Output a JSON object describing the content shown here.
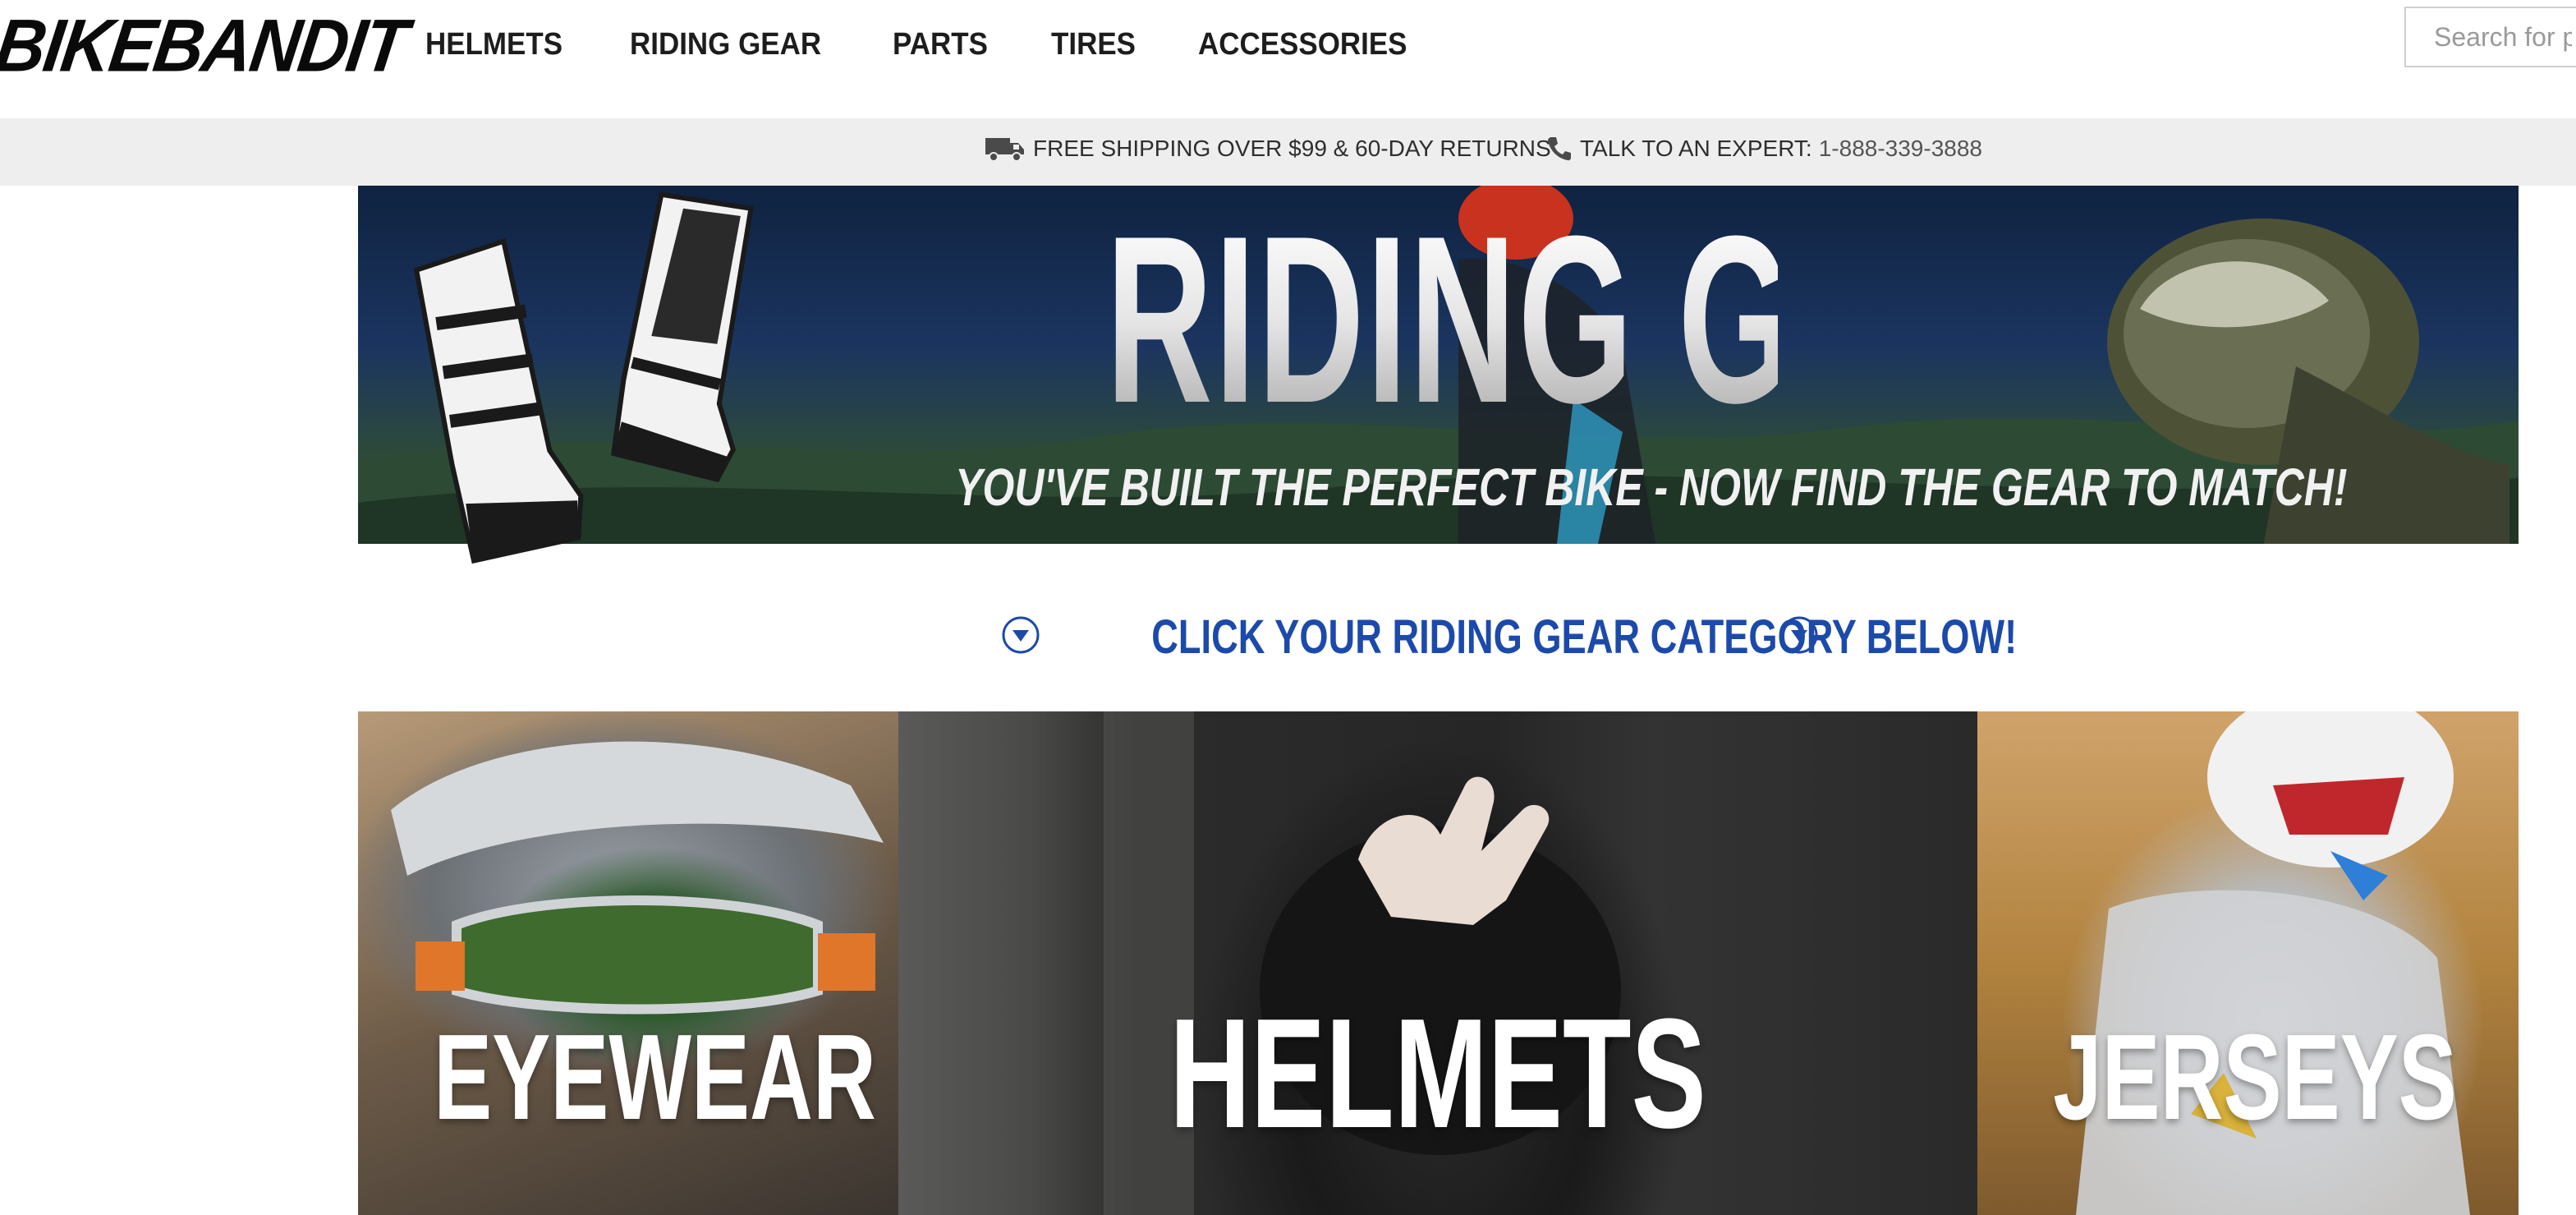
{
  "header": {
    "logo_text": "BIKEBANDIT",
    "nav": [
      {
        "label": "HELMETS"
      },
      {
        "label": "RIDING GEAR"
      },
      {
        "label": "PARTS"
      },
      {
        "label": "TIRES"
      },
      {
        "label": "ACCESSORIES"
      }
    ],
    "search_placeholder": "Search for p"
  },
  "infobar": {
    "shipping_icon": "truck-icon",
    "shipping_text": "FREE SHIPPING OVER $99 & 60-DAY RETURNS",
    "phone_icon": "phone-icon",
    "phone_label": "TALK TO AN EXPERT:",
    "phone_number": "1-888-339-3888"
  },
  "hero": {
    "title": "RIDING GEAR",
    "subtitle": "YOU'VE BUILT THE PERFECT BIKE - NOW FIND THE GEAR TO MATCH!"
  },
  "cta": {
    "text": "CLICK YOUR RIDING GEAR CATEGORY BELOW!",
    "icon": "chevron-down-circle-icon",
    "color": "#1c4aab"
  },
  "categories": [
    {
      "label": "EYEWEAR"
    },
    {
      "label": "HELMETS"
    },
    {
      "label": "JERSEYS"
    }
  ]
}
